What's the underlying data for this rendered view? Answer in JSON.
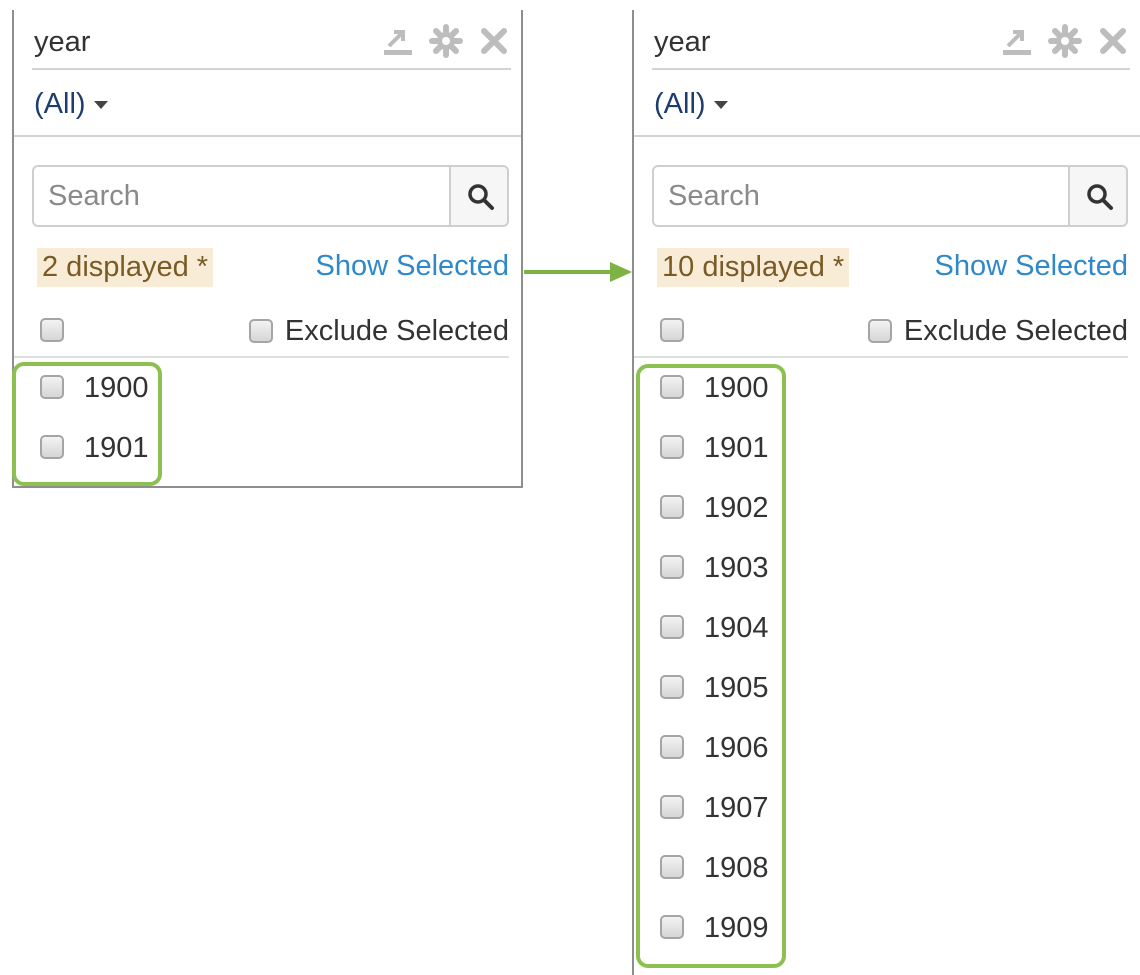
{
  "left_panel": {
    "title": "year",
    "selector": "(All)",
    "search_placeholder": "Search",
    "displayed_count": "2 displayed *",
    "show_selected": "Show Selected",
    "exclude_selected": "Exclude Selected",
    "items": [
      "1900",
      "1901"
    ]
  },
  "right_panel": {
    "title": "year",
    "selector": "(All)",
    "search_placeholder": "Search",
    "displayed_count": "10 displayed *",
    "show_selected": "Show Selected",
    "exclude_selected": "Exclude Selected",
    "items": [
      "1900",
      "1901",
      "1902",
      "1903",
      "1904",
      "1905",
      "1906",
      "1907",
      "1908",
      "1909"
    ]
  },
  "colors": {
    "highlight": "#8cc152",
    "link": "#2f88c9",
    "displayed_bg": "#f8ecd7",
    "selector_text": "#1d3d6f"
  },
  "icons": [
    "export-icon",
    "gear-icon",
    "close-icon",
    "chevron-down-icon",
    "search-icon",
    "arrow-right-icon"
  ]
}
